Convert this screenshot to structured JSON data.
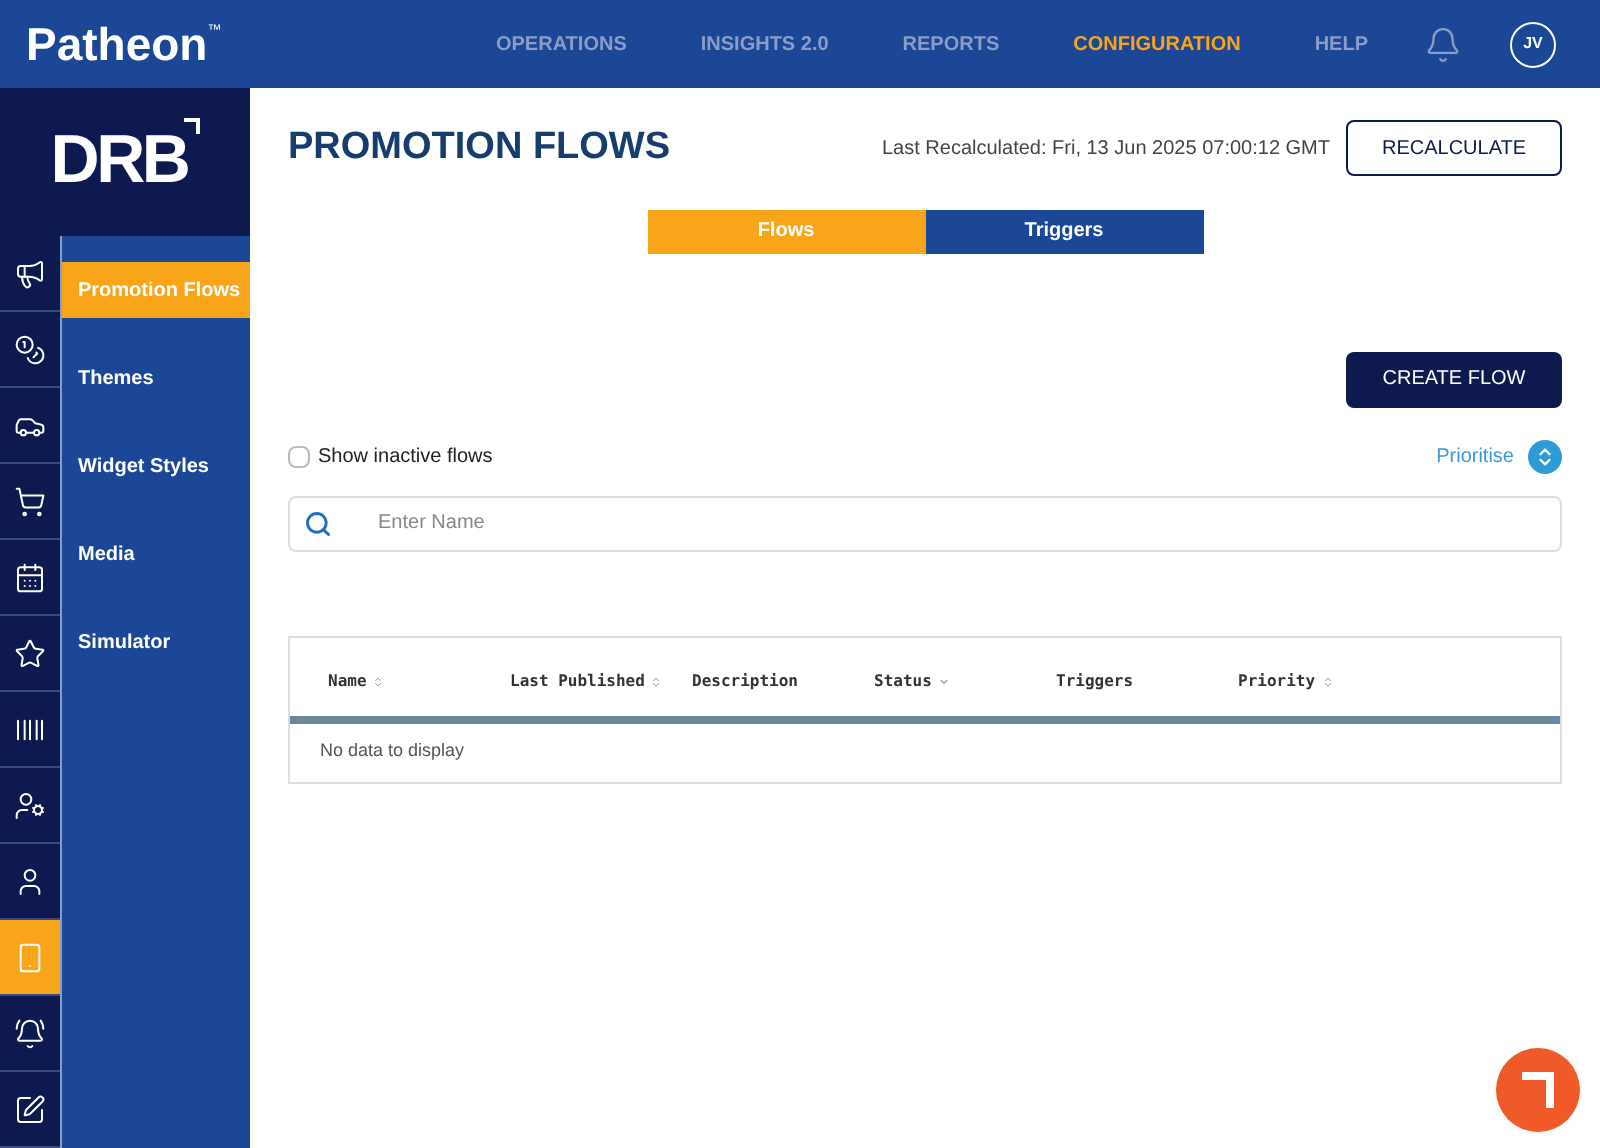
{
  "brand": "Patheon",
  "brand_mark": "™",
  "nav": [
    {
      "label": "OPERATIONS",
      "selected": false
    },
    {
      "label": "INSIGHTS 2.0",
      "selected": false
    },
    {
      "label": "REPORTS",
      "selected": false
    },
    {
      "label": "CONFIGURATION",
      "selected": true
    },
    {
      "label": "HELP",
      "selected": false
    }
  ],
  "user_initials": "JV",
  "logo": "DRB",
  "rail": [
    {
      "kind": "megaphone",
      "selected": false
    },
    {
      "kind": "coins",
      "selected": false
    },
    {
      "kind": "car",
      "selected": false
    },
    {
      "kind": "cart",
      "selected": false
    },
    {
      "kind": "calendar",
      "selected": false
    },
    {
      "kind": "star",
      "selected": false
    },
    {
      "kind": "barcode",
      "selected": false
    },
    {
      "kind": "usercog",
      "selected": false
    },
    {
      "kind": "user",
      "selected": false
    },
    {
      "kind": "device",
      "selected": true
    },
    {
      "kind": "bell",
      "selected": false
    },
    {
      "kind": "edit",
      "selected": false
    }
  ],
  "submenu": [
    {
      "label": "Promotion Flows",
      "selected": true
    },
    {
      "label": "Themes",
      "selected": false
    },
    {
      "label": "Widget Styles",
      "selected": false
    },
    {
      "label": "Media",
      "selected": false
    },
    {
      "label": "Simulator",
      "selected": false
    }
  ],
  "page_title": "PROMOTION FLOWS",
  "last_recalculated": "Last Recalculated: Fri, 13 Jun 2025 07:00:12 GMT",
  "recalculate_button": "RECALCULATE",
  "tabs": [
    {
      "label": "Flows",
      "selected": true
    },
    {
      "label": "Triggers",
      "selected": false
    }
  ],
  "create_button": "CREATE FLOW",
  "show_inactive": {
    "label": "Show inactive flows",
    "checked": false
  },
  "prioritise": "Prioritise",
  "search": {
    "placeholder": "Enter Name"
  },
  "table": {
    "columns": [
      {
        "label": "Name",
        "kind": "sortable"
      },
      {
        "label": "Last Published",
        "kind": "sortable"
      },
      {
        "label": "Description",
        "kind": "plain"
      },
      {
        "label": "Status",
        "kind": "sorted"
      },
      {
        "label": "Triggers",
        "kind": "plain"
      },
      {
        "label": "Priority",
        "kind": "sortable"
      }
    ],
    "empty_text": "No data to display"
  }
}
